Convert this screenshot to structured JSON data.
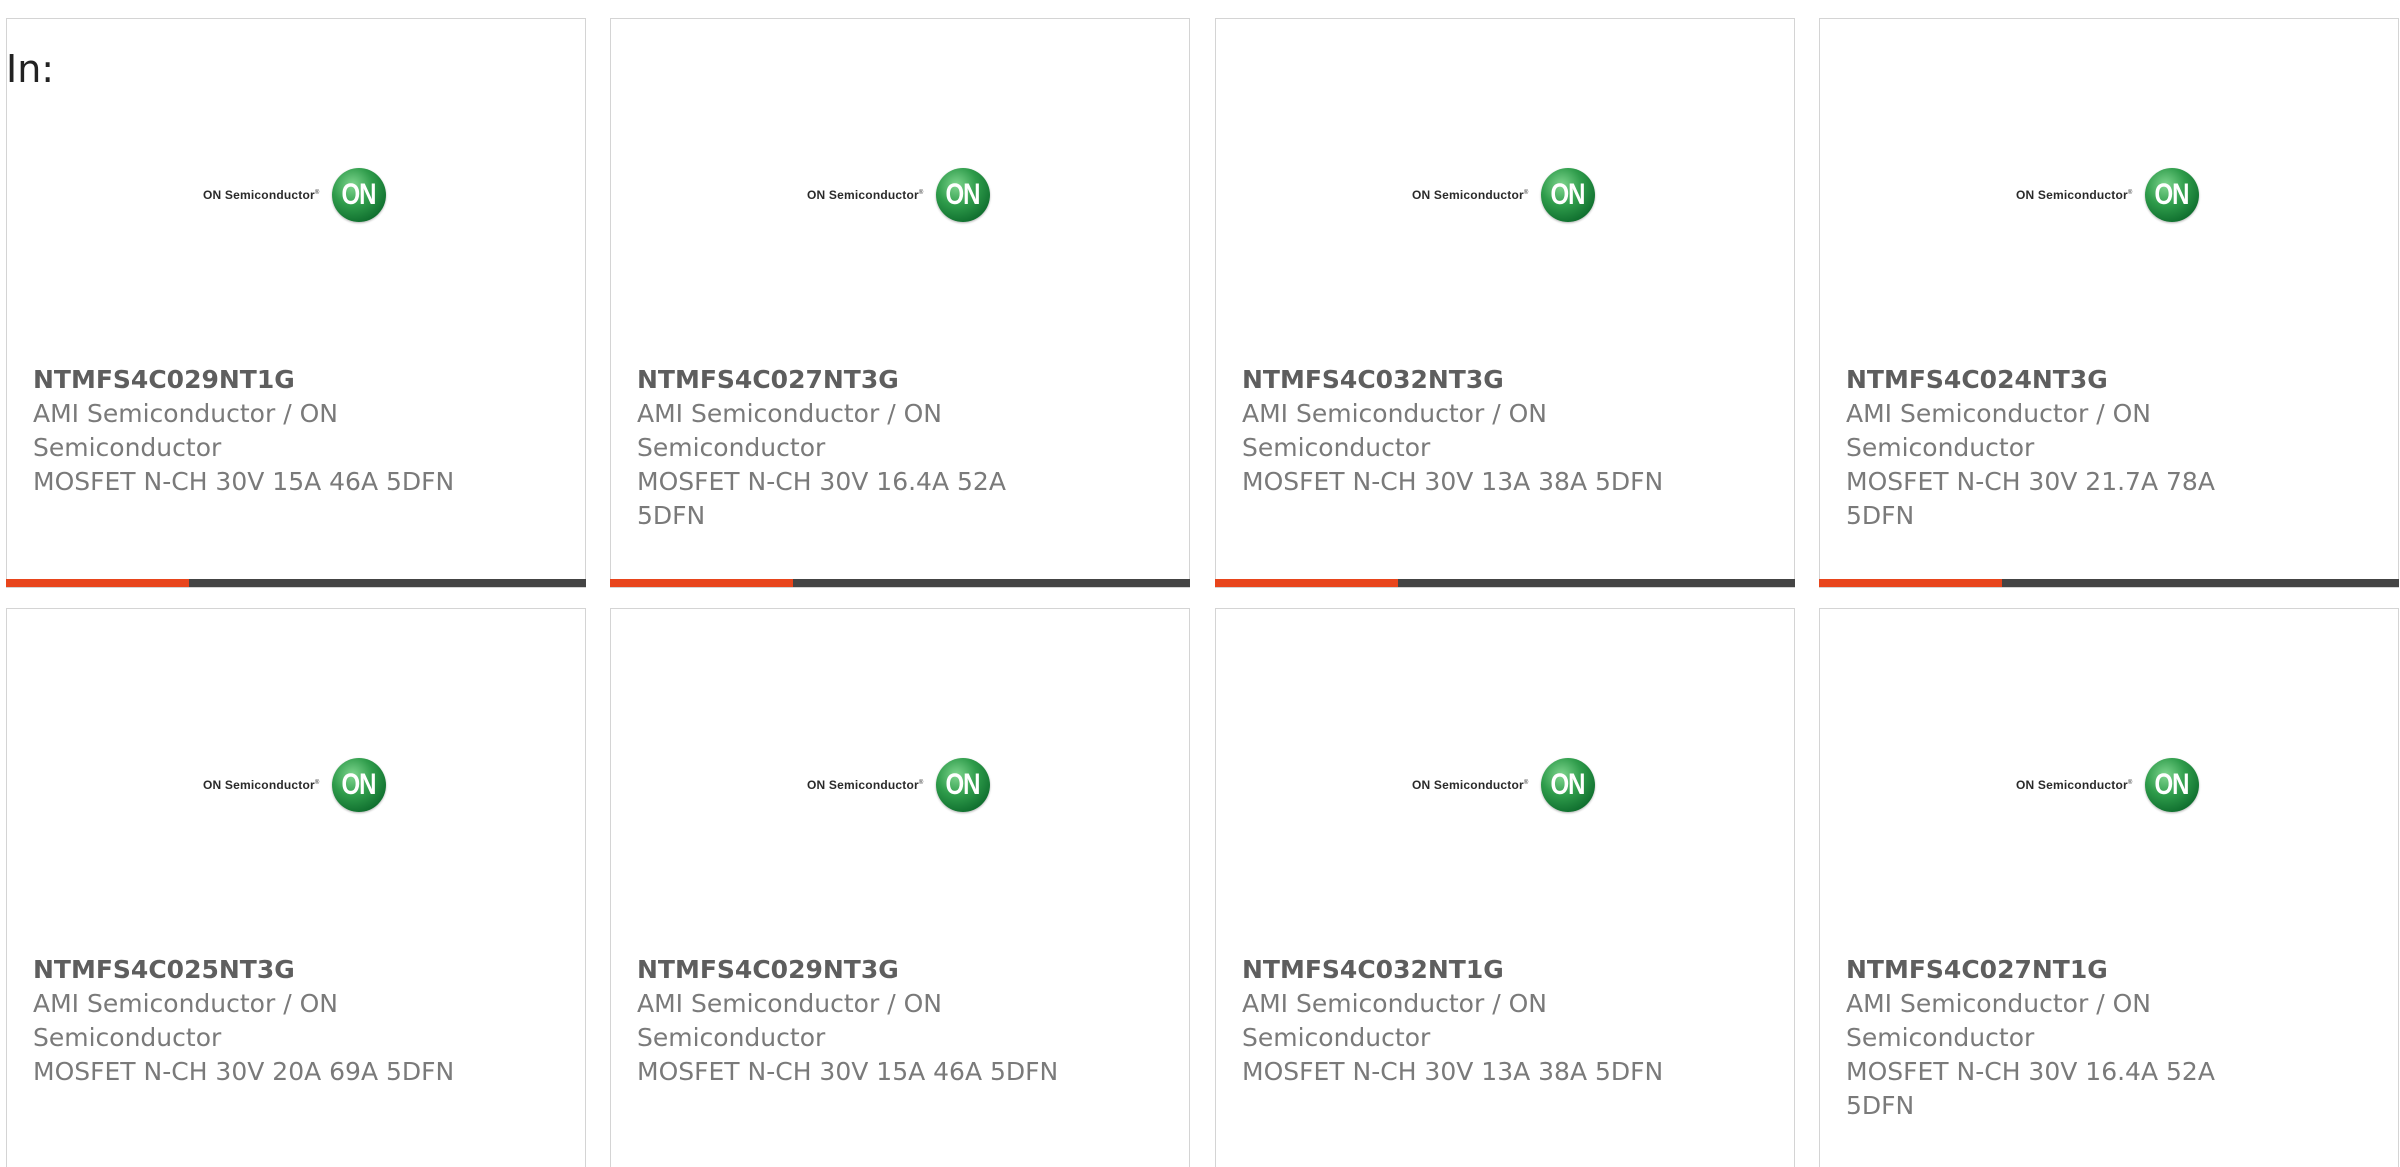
{
  "header": {
    "in_label": "In:"
  },
  "brand": {
    "logo_text": "ON Semiconductor",
    "trademark": "®",
    "badge_text": "ON",
    "accent_color": "#e8451c",
    "track_color": "#444444",
    "badge_color": "#1f8a3d"
  },
  "cards": [
    {
      "part_number": "NTMFS4C029NT1G",
      "manufacturer": "AMI Semiconductor / ON Semiconductor",
      "description": "MOSFET N-CH 30V 15A 46A 5DFN",
      "progress": 0.315
    },
    {
      "part_number": "NTMFS4C027NT3G",
      "manufacturer": "AMI Semiconductor / ON Semiconductor",
      "description": "MOSFET N-CH 30V 16.4A 52A 5DFN",
      "progress": 0.315
    },
    {
      "part_number": "NTMFS4C032NT3G",
      "manufacturer": "AMI Semiconductor / ON Semiconductor",
      "description": "MOSFET N-CH 30V 13A 38A 5DFN",
      "progress": 0.315
    },
    {
      "part_number": "NTMFS4C024NT3G",
      "manufacturer": "AMI Semiconductor / ON Semiconductor",
      "description": "MOSFET N-CH 30V 21.7A 78A 5DFN",
      "progress": 0.315
    },
    {
      "part_number": "NTMFS4C025NT3G",
      "manufacturer": "AMI Semiconductor / ON Semiconductor",
      "description": "MOSFET N-CH 30V 20A 69A 5DFN"
    },
    {
      "part_number": "NTMFS4C029NT3G",
      "manufacturer": "AMI Semiconductor / ON Semiconductor",
      "description": "MOSFET N-CH 30V 15A 46A 5DFN"
    },
    {
      "part_number": "NTMFS4C032NT1G",
      "manufacturer": "AMI Semiconductor / ON Semiconductor",
      "description": "MOSFET N-CH 30V 13A 38A 5DFN"
    },
    {
      "part_number": "NTMFS4C027NT1G",
      "manufacturer": "AMI Semiconductor / ON Semiconductor",
      "description": "MOSFET N-CH 30V 16.4A 52A 5DFN"
    }
  ]
}
